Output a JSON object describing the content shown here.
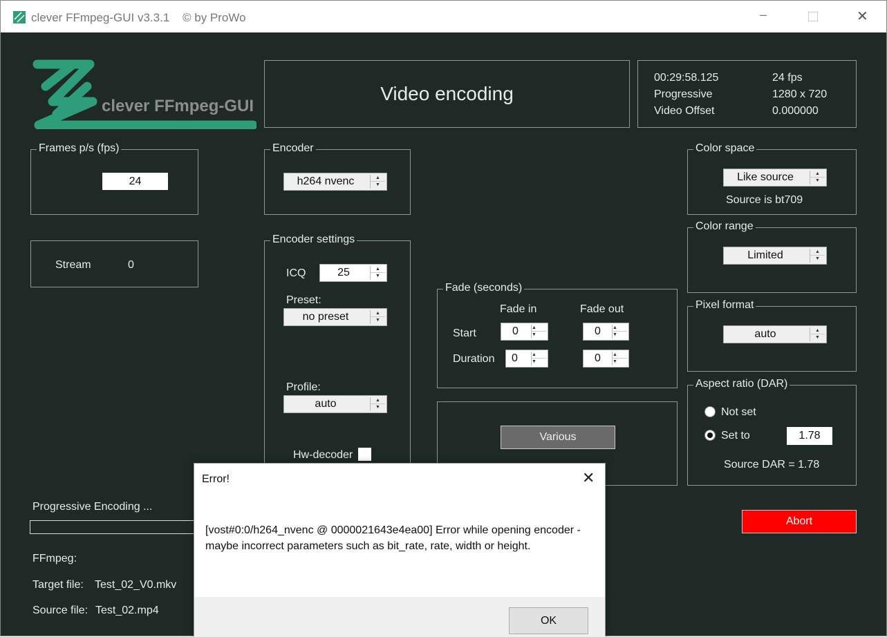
{
  "window": {
    "title": "clever FFmpeg-GUI v3.3.1",
    "copyright": "© by ProWo",
    "logo_text": "clever FFmpeg-GUI",
    "accent": "#2e9e7a"
  },
  "header": {
    "title": "Video encoding"
  },
  "info": {
    "duration": "00:29:58.125",
    "fps": "24 fps",
    "scan": "Progressive",
    "resolution": "1280 x 720",
    "offset_label": "Video Offset",
    "offset_value": "0.000000"
  },
  "fps_group": {
    "label": "Frames p/s (fps)",
    "value": "24"
  },
  "stream": {
    "label": "Stream",
    "value": "0"
  },
  "encoder": {
    "label": "Encoder",
    "value": "h264  nvenc"
  },
  "encoder_settings": {
    "label": "Encoder settings",
    "icq_label": "ICQ",
    "icq_value": "25",
    "preset_label": "Preset:",
    "preset_value": "no preset",
    "profile_label": "Profile:",
    "profile_value": "auto",
    "hw_decoder_label": "Hw-decoder"
  },
  "fade": {
    "label": "Fade (seconds)",
    "fade_in": "Fade in",
    "fade_out": "Fade out",
    "start": "Start",
    "duration": "Duration",
    "start_in": "0",
    "start_out": "0",
    "dur_in": "0",
    "dur_out": "0"
  },
  "various": {
    "label": "Various"
  },
  "color_space": {
    "label": "Color space",
    "value": "Like source",
    "note": "Source is bt709"
  },
  "color_range": {
    "label": "Color range",
    "value": "Limited"
  },
  "pixel_format": {
    "label": "Pixel format",
    "value": "auto"
  },
  "aspect": {
    "label": "Aspect ratio (DAR)",
    "not_set": "Not set",
    "set_to": "Set to",
    "value": "1.78",
    "source": "Source DAR = 1.78"
  },
  "progress": {
    "label": "Progressive Encoding ...",
    "ffmpeg": "FFmpeg:",
    "target_label": "Target file:",
    "target": "Test_02_V0.mkv",
    "source_label": "Source file:",
    "source": "Test_02.mp4"
  },
  "abort": {
    "label": "Abort"
  },
  "dialog": {
    "title": "Error!",
    "message": "[vost#0:0/h264_nvenc @ 0000021643e4ea00] Error while opening encoder - maybe incorrect parameters such as bit_rate, rate, width or height.",
    "ok": "OK"
  }
}
